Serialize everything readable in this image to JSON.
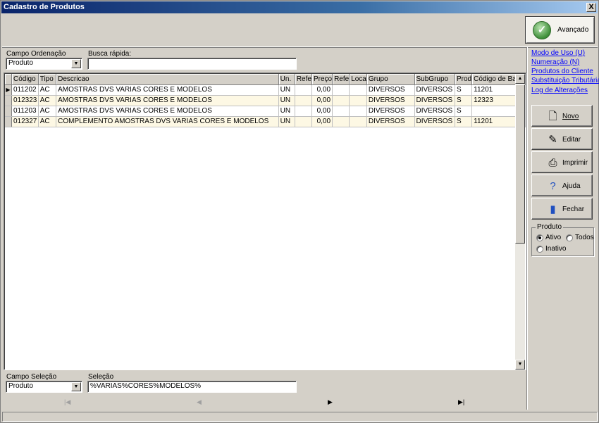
{
  "window": {
    "title": "Cadastro de Produtos",
    "close_label": "X"
  },
  "toolbar": {
    "advanced_label": "Avançado"
  },
  "filters": {
    "order_label": "Campo Ordenação",
    "order_value": "Produto",
    "quick_search_label": "Busca rápida:",
    "quick_search_value": "",
    "selection_field_label": "Campo Seleção",
    "selection_field_value": "Produto",
    "selection_label": "Seleção",
    "selection_value": "%VARIAS%CORES%MODELOS%"
  },
  "table": {
    "columns": [
      "Código",
      "Tipo",
      "Descricao",
      "Un.",
      "Refe",
      "Preço",
      "Refe",
      "Loca",
      "Grupo",
      "SubGrupo",
      "Prod",
      "Código de Barra"
    ],
    "rows": [
      [
        "011202",
        "AC",
        "AMOSTRAS DVS VARIAS CORES E MODELOS",
        "UN",
        "",
        "0,00",
        "",
        "",
        "DIVERSOS",
        "DIVERSOS",
        "S",
        "11201"
      ],
      [
        "012323",
        "AC",
        "AMOSTRAS DVS VARIAS CORES E MODELOS",
        "UN",
        "",
        "0,00",
        "",
        "",
        "DIVERSOS",
        "DIVERSOS",
        "S",
        "12323"
      ],
      [
        "011203",
        "AC",
        "AMOSTRAS DVS VARIAS CORES E MODELOS",
        "UN",
        "",
        "0,00",
        "",
        "",
        "DIVERSOS",
        "DIVERSOS",
        "S",
        ""
      ],
      [
        "012327",
        "AC",
        "COMPLEMENTO AMOSTRAS DVS VARIAS CORES E MODELOS",
        "UN",
        "",
        "0,00",
        "",
        "",
        "DIVERSOS",
        "DIVERSOS",
        "S",
        "11201"
      ]
    ],
    "selected_row": 0
  },
  "sidebar": {
    "links": [
      "Modo de Uso (U)",
      "Numeração (N)",
      "Produtos do Cliente",
      "Substituição Tributária",
      "Log de Alterações"
    ],
    "buttons": [
      {
        "label": "Novo",
        "icon": "new-document-icon"
      },
      {
        "label": "Editar",
        "icon": "edit-icon"
      },
      {
        "label": "Imprimir",
        "icon": "printer-icon"
      },
      {
        "label": "Ajuda",
        "icon": "help-icon"
      },
      {
        "label": "Fechar",
        "icon": "exit-door-icon"
      }
    ],
    "product_group": {
      "title": "Produto",
      "options": [
        "Ativo",
        "Todos",
        "Inativo"
      ],
      "selected": "Ativo"
    }
  },
  "navigation": {
    "first": "|◀",
    "prev": "◀",
    "next": "▶",
    "last": "▶|"
  },
  "colors": {
    "title_bar": "#0a246a",
    "link": "#0000ff",
    "alt_row": "#fdf8e4"
  }
}
